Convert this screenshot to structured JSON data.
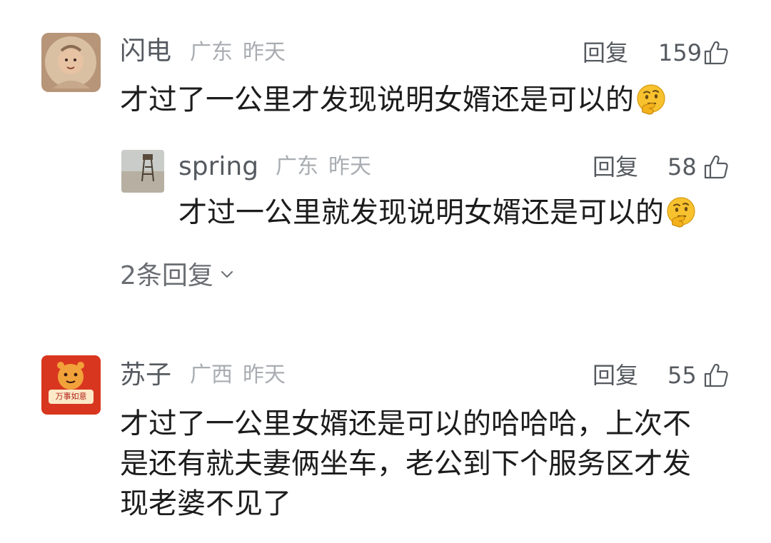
{
  "comments": [
    {
      "name": "闪电",
      "region": "广东",
      "time": "昨天",
      "reply_label": "回复",
      "likes": "159",
      "text": "才过了一公里才发现说明女婿还是可以的",
      "emoji": "thinking-face-emoji",
      "replies": [
        {
          "name": "spring",
          "region": "广东",
          "time": "昨天",
          "reply_label": "回复",
          "likes": "58",
          "text": "才过一公里就发现说明女婿还是可以的",
          "emoji": "thinking-face-emoji"
        }
      ],
      "more_replies": "2条回复"
    },
    {
      "name": "苏子",
      "region": "广西",
      "time": "昨天",
      "reply_label": "回复",
      "likes": "55",
      "text_lines": [
        "才过了一公里女婿还是可以的哈哈哈，上次不",
        "是还有就夫妻俩坐车，老公到下个服务区才发",
        "现老婆不见了"
      ],
      "avatar_text": "万事如意"
    }
  ],
  "colors": {
    "name": "#555a60",
    "meta": "#a9adb2",
    "text": "#1c1c1c",
    "background": "#ffffff",
    "avatar2_red": "#d9361f"
  }
}
